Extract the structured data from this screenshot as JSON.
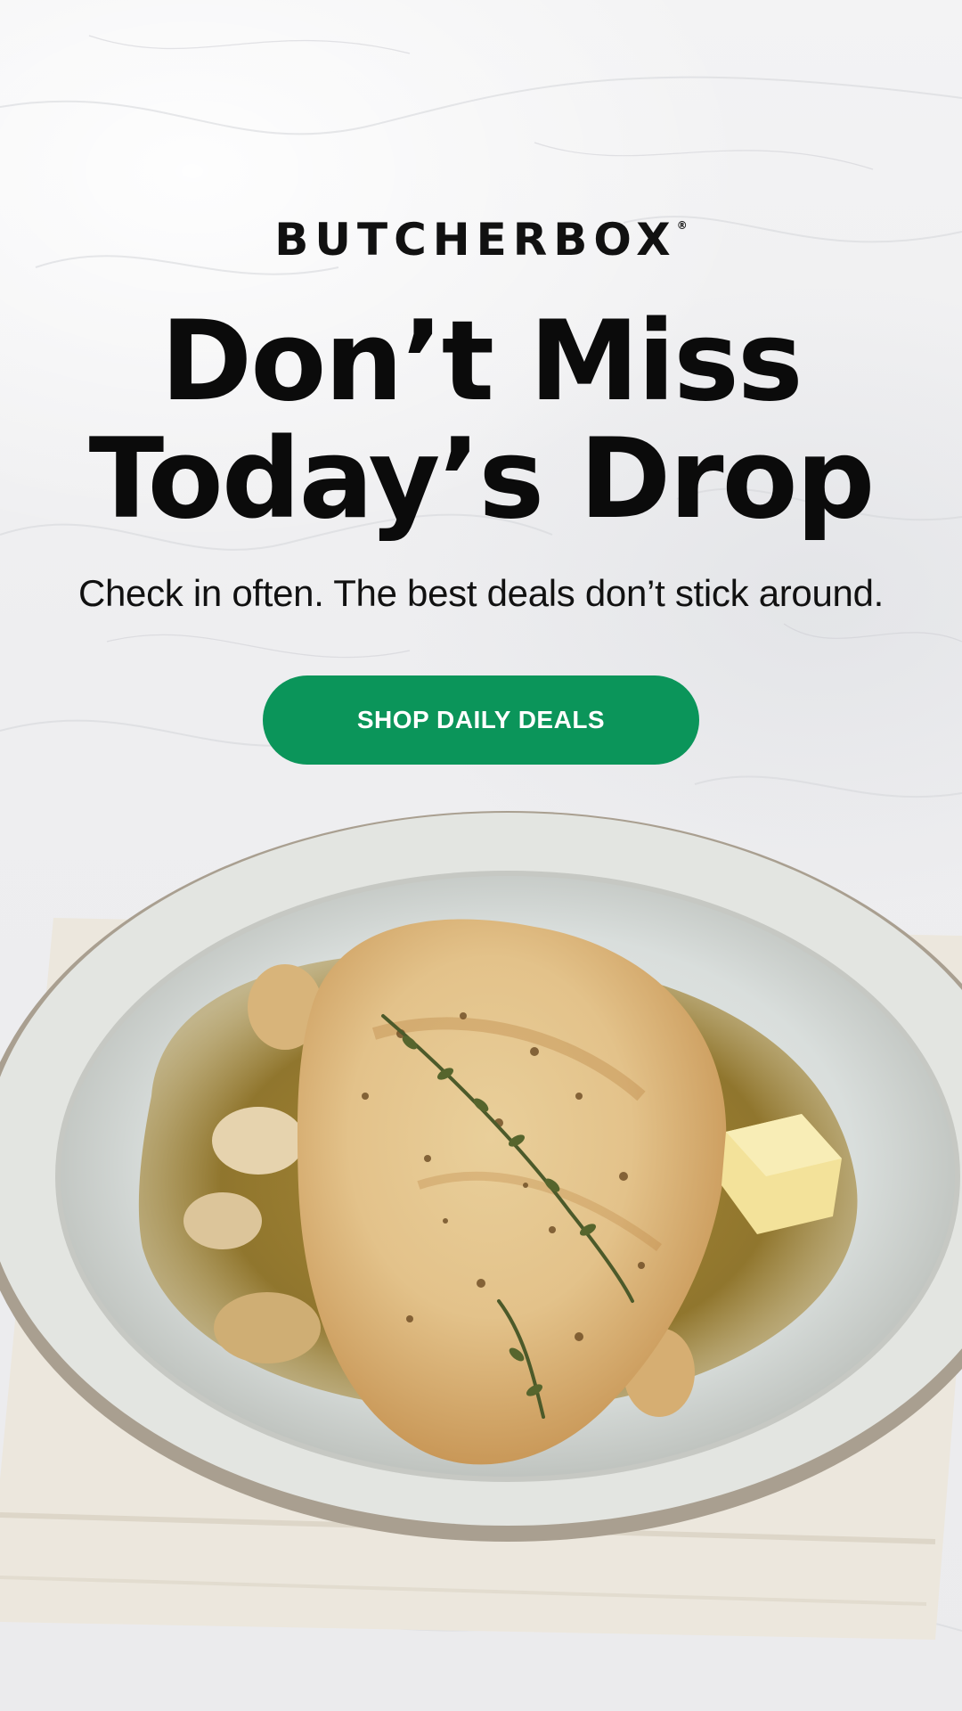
{
  "brand": {
    "name": "BUTCHERBOX",
    "registered_mark": "®"
  },
  "hero": {
    "headline_line1": "Don’t Miss",
    "headline_line2": "Today’s Drop",
    "subheadline": "Check in often. The best deals don’t stick around."
  },
  "cta": {
    "label": "SHOP DAILY DEALS"
  },
  "colors": {
    "cta_green": "#0b955a",
    "text": "#0b0b0b",
    "background": "#eeeef0"
  },
  "image": {
    "subject": "plate-chicken-icon"
  }
}
